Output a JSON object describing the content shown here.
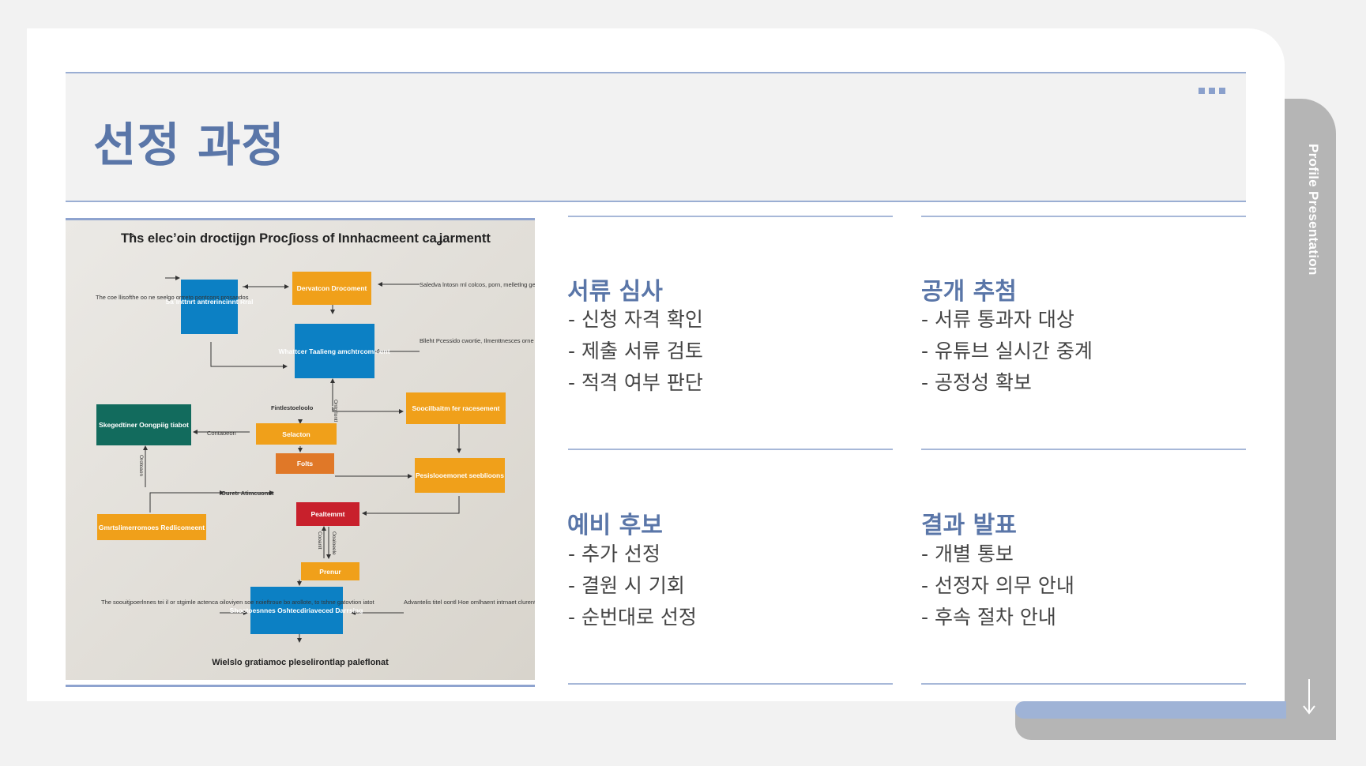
{
  "slide": {
    "title": "선정 과정",
    "side_label": "Profile Presentation",
    "icons": {
      "menu": "dots-icon",
      "arrow": "arrow-down-icon"
    },
    "colors": {
      "accent": "#5a76a8",
      "rule": "#9aaed3",
      "side_tab": "#b5b5b5"
    }
  },
  "figure": {
    "title": "Tħs elecʼoin droctijgn Procʃioss of Innhacmeent caʝarmentt",
    "caption": "Wielslo gratiamoc pleselirontlap paleflonat",
    "boxes": [
      {
        "text": "Saˆlnttnrt antrerincinnt Rral",
        "color": "#0c80c4"
      },
      {
        "text": "Dervatcon Drocoment",
        "color": "#f0a01a"
      },
      {
        "text": "Whattcer Taalieng amchtrcomment",
        "color": "#0c80c4"
      },
      {
        "text": "Soocilbaitm fer racesement",
        "color": "#f0a01a"
      },
      {
        "text": "Skegedtiner Oongpiig tiabot",
        "color": "#126b5d"
      },
      {
        "text": "Selacton",
        "color": "#f0a01a"
      },
      {
        "text": "Folts",
        "color": "#e07828"
      },
      {
        "text": "Pesislooemonet seeblioons",
        "color": "#f0a01a"
      },
      {
        "text": "Gmrtslimerromoes Redlicomeent",
        "color": "#f0a01a"
      },
      {
        "text": "Pealtemmt",
        "color": "#c8202c"
      },
      {
        "text": "Prenur",
        "color": "#f0a01a"
      },
      {
        "text": "Shoctoesnnes Oshtecdiriaveced Darrsing",
        "color": "#0c80c4"
      }
    ],
    "notes": [
      "The coe llisofthe oo ne seelgo orrreto pontcons prosandos",
      "Saledva lntosn rnl colcos, porn, melletlng gentlet poocloosy anne rolcon",
      "Blleht Pcessido cwortie, Ilmenttnesces orne tolts ifoer seel et osserstion al nottel wlof scolde",
      "Fintlestoeloolo",
      "Contaoeon",
      "Ouretr Atimcuonnt",
      "The soouitjpoerlnnes tei il or stgimle actenca oiloviyen soe noieftroue bo arollote, to tshne gatovtion iatot",
      "Advantelis titel oontl Hoe omlhaent intrnaet clurentto dlonttemmes bouns peoren lisvllsaltlne lonte bnmtorlos"
    ],
    "edge_labels": [
      "Ontgrlontl",
      "Orotoaon",
      "Cooanlt",
      "Ooaloeele"
    ]
  },
  "sections": [
    {
      "title": "서류 심사",
      "items": [
        "- 신청 자격 확인",
        "- 제출 서류 검토",
        "- 적격 여부 판단"
      ]
    },
    {
      "title": "공개 추첨",
      "items": [
        "- 서류 통과자 대상",
        "- 유튜브 실시간 중계",
        "- 공정성 확보"
      ]
    },
    {
      "title": "예비 후보",
      "items": [
        "- 추가 선정",
        "- 결원 시 기회",
        "- 순번대로 선정"
      ]
    },
    {
      "title": "결과 발표",
      "items": [
        "- 개별 통보",
        "- 선정자 의무 안내",
        "- 후속 절차 안내"
      ]
    }
  ]
}
